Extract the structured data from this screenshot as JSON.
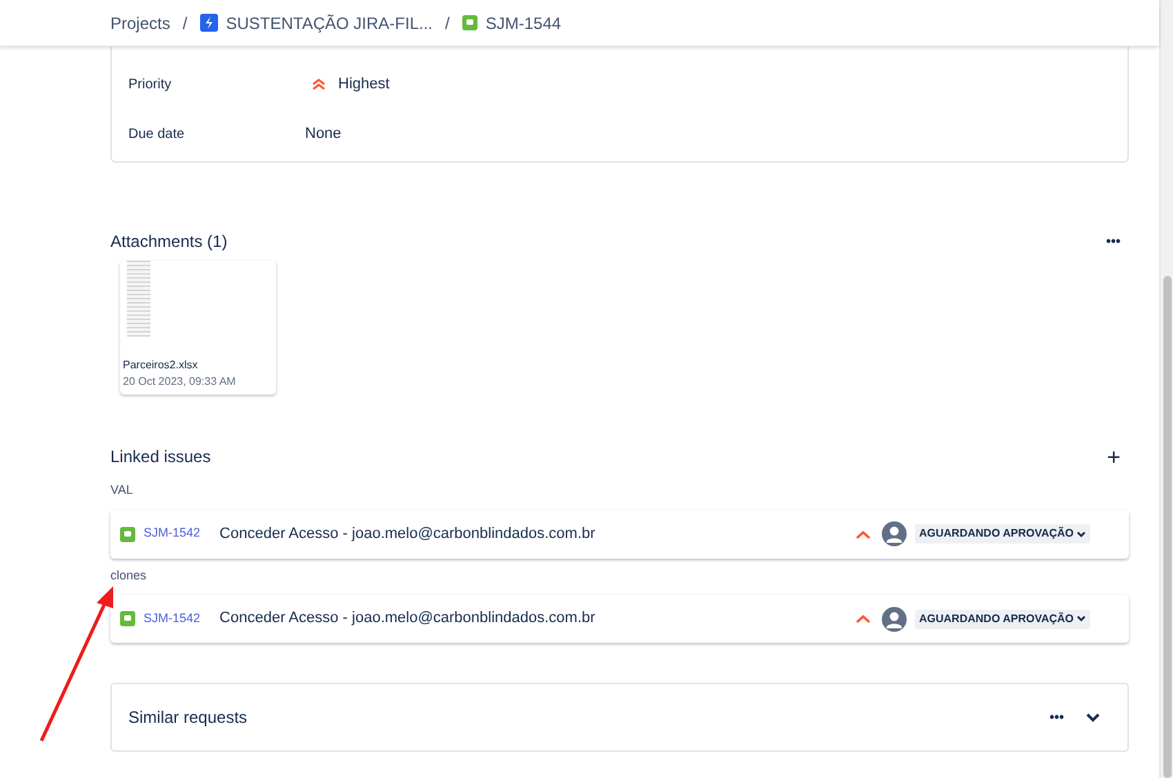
{
  "breadcrumb": [
    {
      "kind": "text",
      "label": "Projects"
    },
    {
      "kind": "project",
      "separator": "/",
      "label": "SUSTENTAÇÃO JIRA-FIL..."
    },
    {
      "kind": "issue",
      "separator": "/",
      "label": "SJM-1544"
    }
  ],
  "fields": [
    {
      "kind": "priority",
      "label": "Priority",
      "value": "Highest"
    },
    {
      "kind": "text",
      "label": "Due date",
      "value": "None"
    }
  ],
  "attachments": {
    "title": "Attachments (1)",
    "more": "•••",
    "files": [
      {
        "name": "Parceiros2.xlsx",
        "date": "20 Oct 2023, 09:33 AM"
      }
    ]
  },
  "linked_issues": {
    "title": "Linked issues",
    "add": "+",
    "groups": [
      {
        "relation": "VAL",
        "issues": [
          {
            "key": "SJM-1542",
            "summary": "Conceder Acesso - joao.melo@carbonblindados.com.br",
            "status": "AGUARDANDO APROVAÇÃO"
          }
        ]
      },
      {
        "relation": "clones",
        "issues": [
          {
            "key": "SJM-1542",
            "summary": "Conceder Acesso - joao.melo@carbonblindados.com.br",
            "status": "AGUARDANDO APROVAÇÃO"
          }
        ]
      }
    ]
  },
  "similar_requests": {
    "title": "Similar requests",
    "more": "•••"
  }
}
